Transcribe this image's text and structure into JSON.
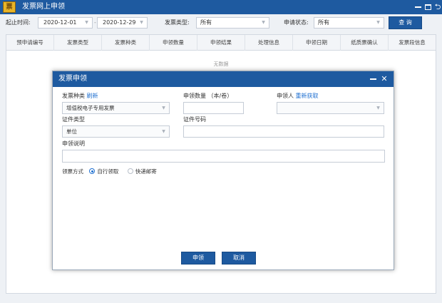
{
  "window": {
    "logo_text": "票",
    "title": "发票网上申领",
    "icons": [
      "minimize-icon",
      "restore-icon",
      "exit-icon"
    ]
  },
  "filters": {
    "date_label": "起止时间:",
    "start_date": "2020-12-01",
    "date_separator": "-",
    "end_date": "2020-12-29",
    "invoice_type_label": "发票类型:",
    "invoice_type_value": "所有",
    "status_label": "申请状态:",
    "status_value": "所有",
    "query_button": "查 询"
  },
  "table": {
    "columns": [
      "预申请编号",
      "发票类型",
      "发票种类",
      "申领数量",
      "申领结果",
      "处理信息",
      "申领日期",
      "纸质票确认",
      "发票段信息"
    ],
    "empty_text": "无数据"
  },
  "modal": {
    "title": "发票申领",
    "invoice_kind_label": "发票种类",
    "refresh_link": "刷新",
    "invoice_kind_value": "增值税电子专用发票",
    "quantity_label": "申领数量 （本/卷）",
    "quantity_value": "",
    "applicant_label": "申领人",
    "reacquire_link": "重新获取",
    "applicant_value": "",
    "cert_type_label": "证件类型",
    "cert_type_value": "单位",
    "cert_no_label": "证件号码",
    "cert_no_value": "",
    "description_label": "申领说明",
    "description_value": "",
    "method_label": "领票方式",
    "method_options": [
      "自行领取",
      "快递邮寄"
    ],
    "method_selected": "自行领取",
    "apply_button": "申领",
    "cancel_button": "取消"
  },
  "colors": {
    "brand": "#1e5aa0",
    "link": "#1e6fd0",
    "background": "#eef1f5"
  }
}
